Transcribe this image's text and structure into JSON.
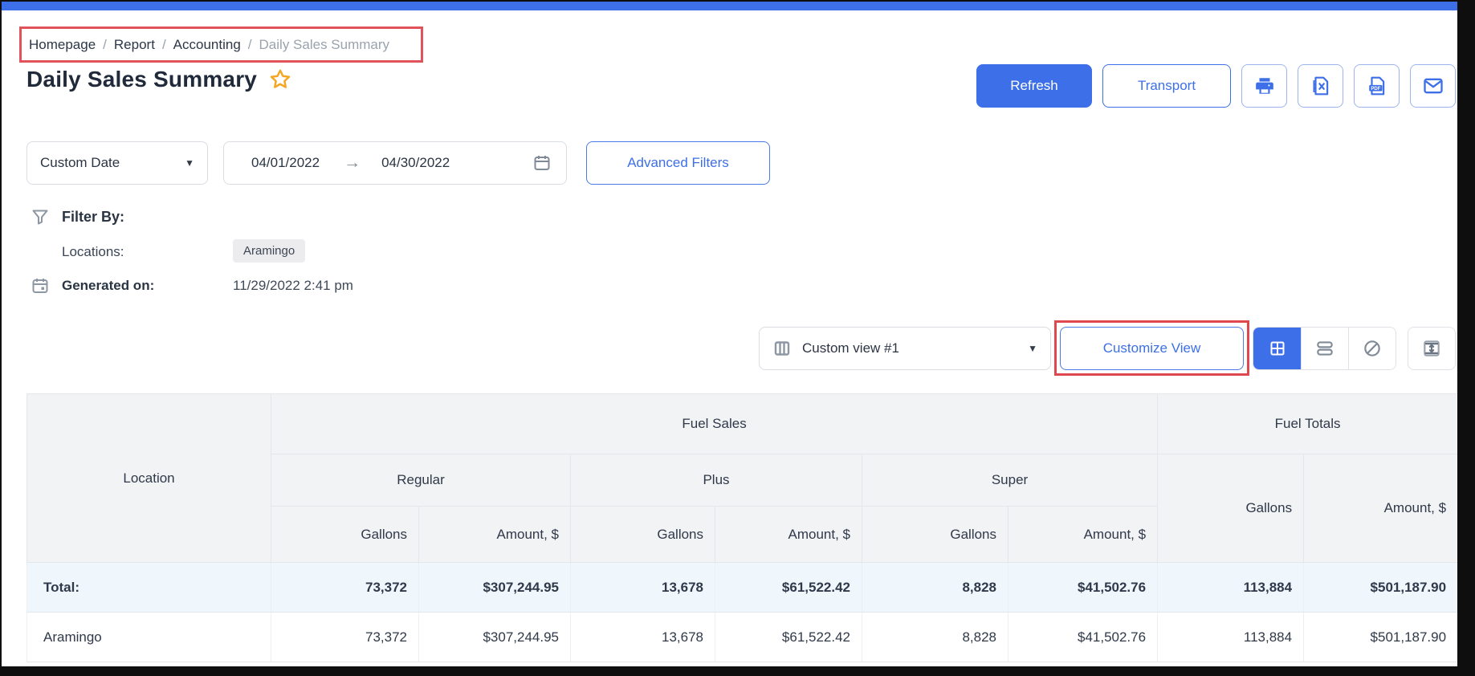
{
  "breadcrumb": {
    "separator": "/",
    "items": [
      "Homepage",
      "Report",
      "Accounting",
      "Daily Sales Summary"
    ]
  },
  "page": {
    "title": "Daily Sales Summary"
  },
  "header_actions": {
    "refresh_label": "Refresh",
    "transport_label": "Transport"
  },
  "filters": {
    "period_value": "Custom Date",
    "date_from": "04/01/2022",
    "date_to": "04/30/2022",
    "advanced_label": "Advanced Filters",
    "filter_by_label": "Filter By:",
    "locations_label": "Locations:",
    "locations_value": "Aramingo",
    "generated_label": "Generated on:",
    "generated_value": "11/29/2022 2:41 pm"
  },
  "view_controls": {
    "view_select_value": "Custom view #1",
    "customize_label": "Customize View"
  },
  "icons": {
    "dropdown": "▼",
    "range_arrow": "→",
    "favorite": "star-outline",
    "print": "printer",
    "export_excel": "excel-file",
    "export_pdf": "pdf-file",
    "email": "envelope",
    "filter": "funnel",
    "calendar": "calendar",
    "view_columns": "columns",
    "grid_view": "grid",
    "row_view": "rows",
    "chart_view": "pie-chart",
    "expand_view": "row-height"
  },
  "colors": {
    "accent": "#3d6fe8",
    "highlight_red": "#e0484f",
    "star": "#f5a623",
    "header_bg": "#f2f3f5",
    "total_row_bg": "#eff7fd",
    "badge_bg": "#ececee",
    "border": "#e3e6ea",
    "muted": "#9aa3ad"
  },
  "table": {
    "header": {
      "location": "Location",
      "fuel_sales": "Fuel Sales",
      "fuel_totals": "Fuel Totals",
      "grades": [
        "Regular",
        "Plus",
        "Super"
      ],
      "gallons": "Gallons",
      "amount": "Amount, $"
    },
    "rows": [
      {
        "label": "Total:",
        "values": [
          "73,372",
          "$307,244.95",
          "13,678",
          "$61,522.42",
          "8,828",
          "$41,502.76",
          "113,884",
          "$501,187.90"
        ]
      },
      {
        "label": "Aramingo",
        "values": [
          "73,372",
          "$307,244.95",
          "13,678",
          "$61,522.42",
          "8,828",
          "$41,502.76",
          "113,884",
          "$501,187.90"
        ]
      }
    ]
  }
}
